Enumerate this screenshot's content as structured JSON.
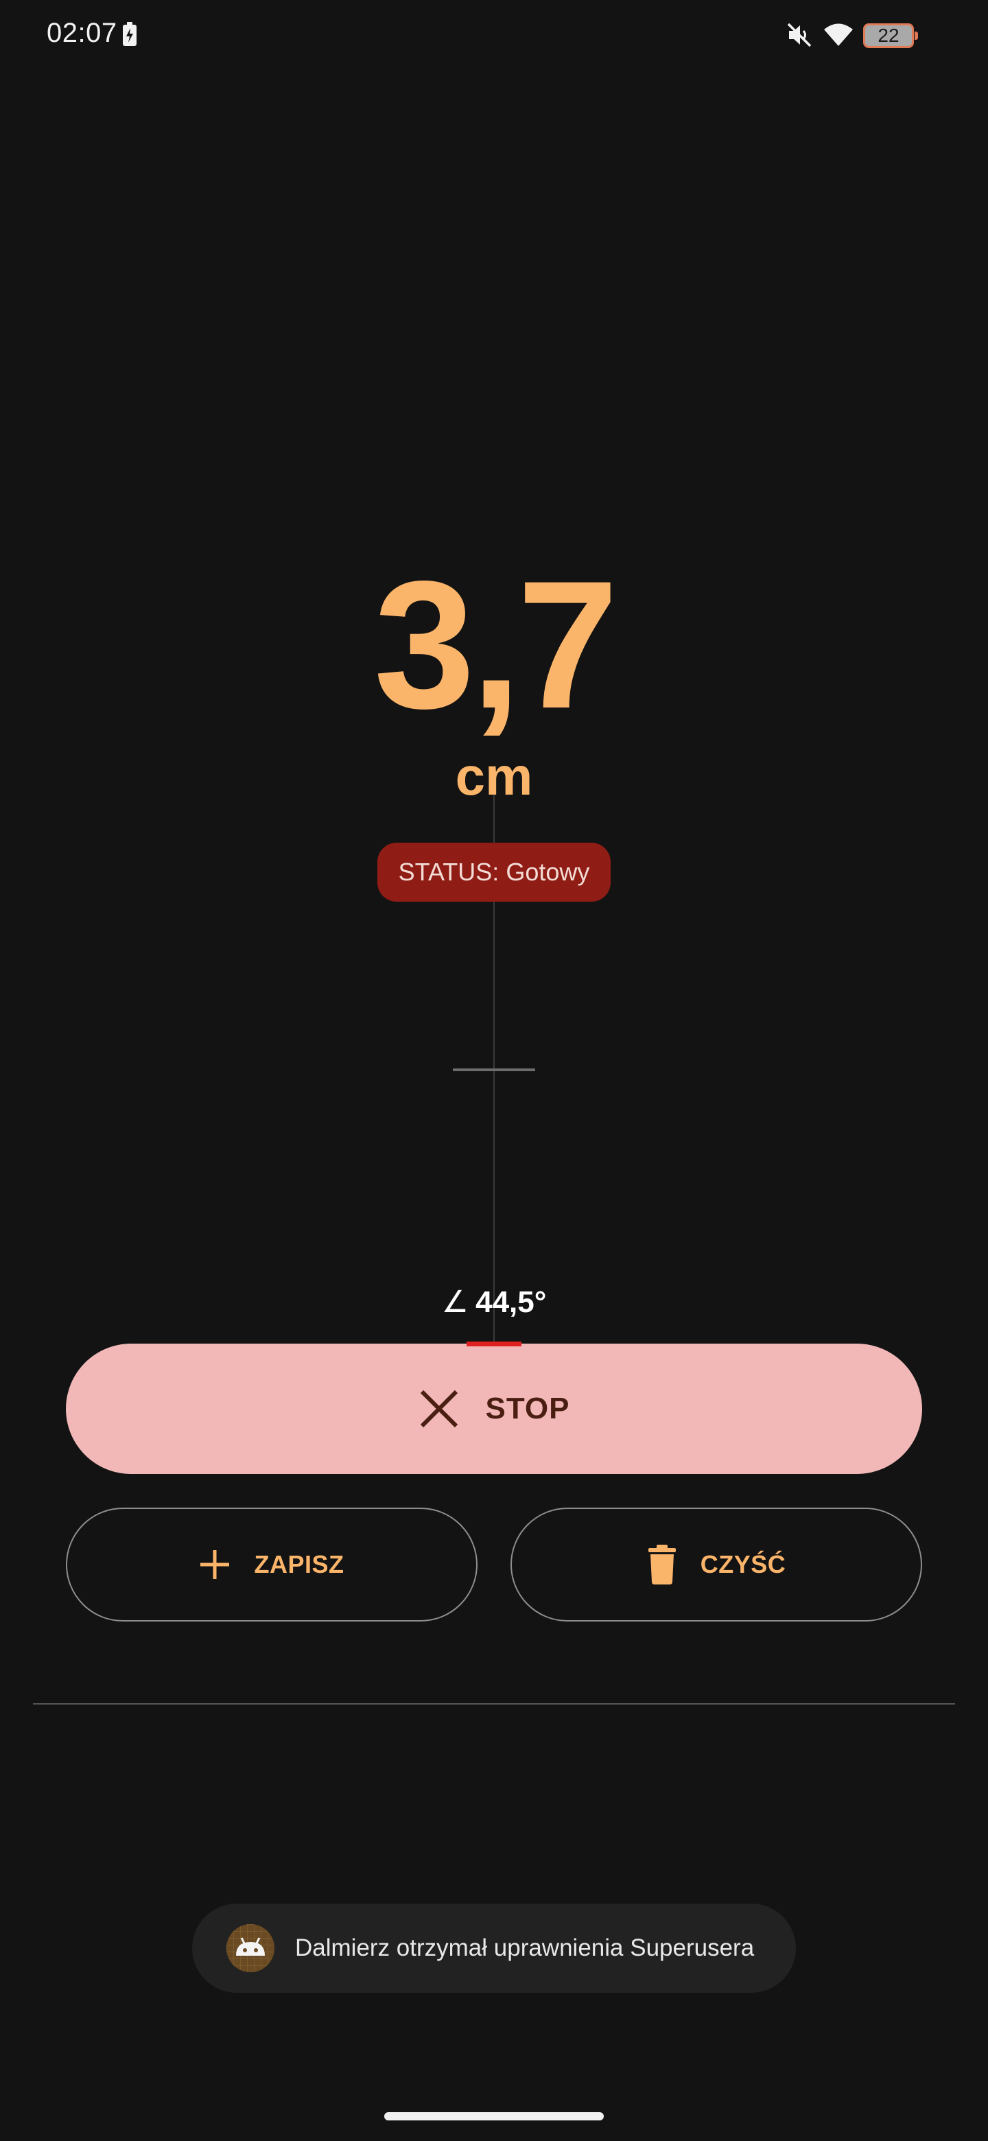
{
  "status_bar": {
    "time": "02:07",
    "battery_level": "22",
    "icons": [
      "battery-charging-icon",
      "mute-icon",
      "wifi-icon",
      "battery-icon"
    ]
  },
  "measurement": {
    "value": "3,7",
    "unit": "cm",
    "status": "STATUS: Gotowy",
    "angle_symbol": "∠",
    "angle_value": "44,5°"
  },
  "actions": {
    "stop_label": "STOP",
    "save_label": "ZAPISZ",
    "clear_label": "CZYŚĆ"
  },
  "toast": {
    "message": "Dalmierz otrzymał uprawnienia Superusera"
  },
  "colors": {
    "background": "#131313",
    "accent": "#fbb56a",
    "status_pill": "#8f1d16",
    "stop_button": "#f2b8b8",
    "level_marker": "#e02020"
  }
}
